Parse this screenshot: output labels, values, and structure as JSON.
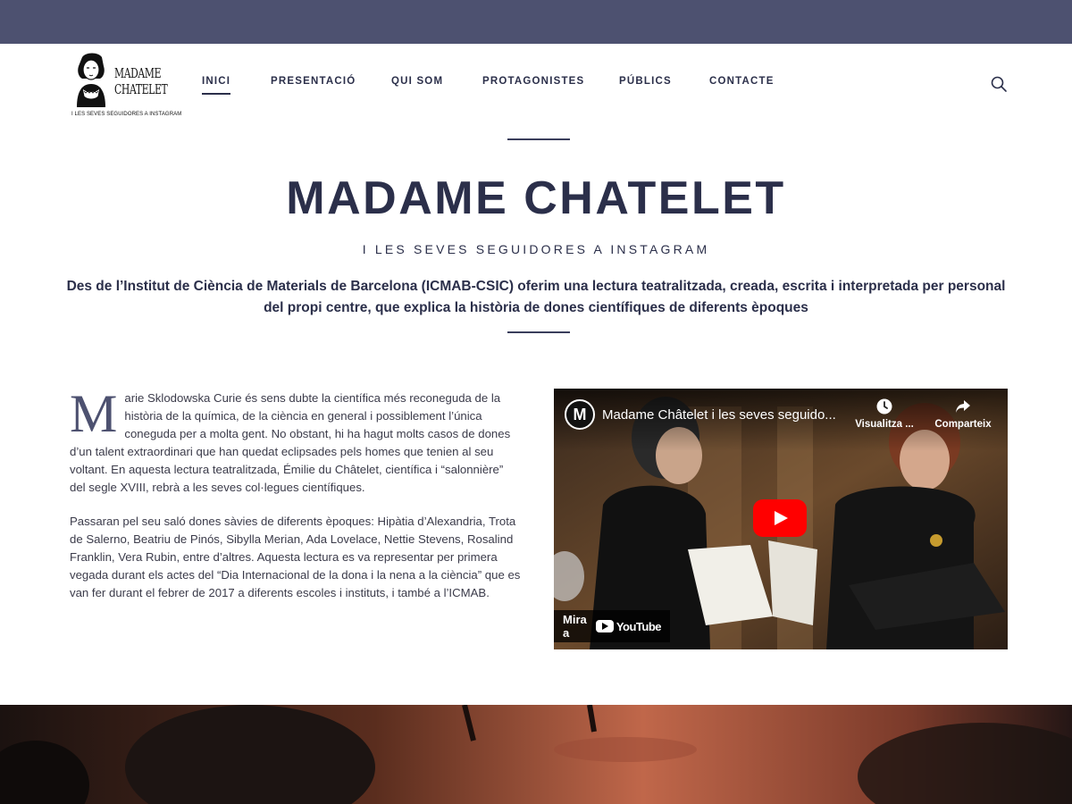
{
  "header": {
    "logo": {
      "word1": "MADAME",
      "word2": "CHATELET",
      "subtitle": "I LES SEVES SEGUIDORES A INSTAGRAM"
    },
    "nav": [
      {
        "label": "INICI",
        "active": true
      },
      {
        "label": "PRESENTACIÓ",
        "active": false
      },
      {
        "label": "QUI SOM",
        "active": false
      },
      {
        "label": "PROTAGONISTES",
        "active": false
      },
      {
        "label": "PÚBLICS",
        "active": false
      },
      {
        "label": "CONTACTE",
        "active": false
      }
    ],
    "search_icon": "search-icon"
  },
  "hero": {
    "title": "MADAME CHATELET",
    "subtitle": "I LES SEVES SEGUIDORES A INSTAGRAM",
    "description": "Des de l’Institut de Ciència de Materials de Barcelona (ICMAB-CSIC) oferim una lectura teatralitzada, creada, escrita i interpretada per personal del propi centre, que explica la història de dones científiques de diferents èpoques"
  },
  "article": {
    "dropcap": "M",
    "paragraph1": "arie Sklodowska Curie és sens dubte la científica més reconeguda de la història de la química, de la ciència en general i possiblement l’única coneguda per a molta gent. No obstant, hi ha hagut molts casos de dones d’un talent extraordinari que han quedat eclipsades pels homes que tenien al seu voltant. En aquesta lectura teatralitzada, Émilie du Châtelet, científica i “salonnière” del segle XVIII, rebrà a les seves col·legues científiques.",
    "paragraph2": "Passaran pel seu saló dones sàvies de diferents èpoques: Hipàtia d’Alexandria, Trota de Salerno, Beatriu de Pinós, Sibylla Merian, Ada Lovelace, Nettie Stevens, Rosalind Franklin, Vera Rubin, entre d’altres. Aquesta lectura es va representar per primera vegada durant els actes del “Dia Internacional de la dona i la nena a la ciència” que es van fer durant el febrer de 2017 a diferents escoles i instituts, i també a l’ICMAB."
  },
  "video": {
    "channel_initial": "M",
    "title": "Madame Châtelet i les seves seguido...",
    "watch_later": "Visualitza ...",
    "share": "Comparteix",
    "watch_on": "Mira a",
    "brand": "YouTube"
  },
  "colors": {
    "topbar": "#4d5170",
    "text": "#2b2f4a",
    "youtube_red": "#ff0000"
  }
}
